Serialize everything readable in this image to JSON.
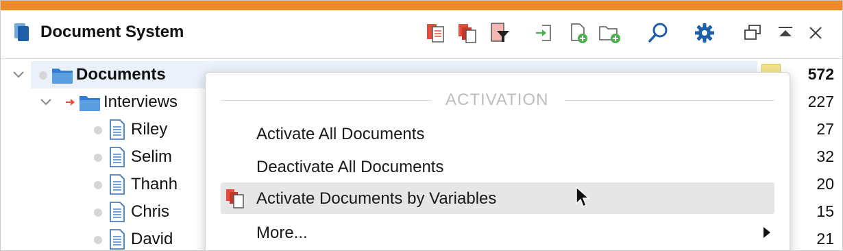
{
  "window": {
    "title": "Document System"
  },
  "toolbar": {
    "icons": [
      "documents-activate-icon",
      "documents-copy-icon",
      "document-filter-icon",
      "import-icon",
      "new-document-icon",
      "new-folder-icon",
      "search-icon",
      "settings-gear-icon",
      "undock-window-icon",
      "collapse-icon",
      "close-icon"
    ],
    "accent": "#ef8a2c"
  },
  "tree": {
    "root": {
      "label": "Documents",
      "count": "572"
    },
    "group": {
      "label": "Interviews",
      "count": "227"
    },
    "docs": [
      {
        "label": "Riley",
        "count": "27"
      },
      {
        "label": "Selim",
        "count": "32"
      },
      {
        "label": "Thanh",
        "count": "20"
      },
      {
        "label": "Chris",
        "count": "15"
      },
      {
        "label": "David",
        "count": "21"
      }
    ]
  },
  "context_menu": {
    "section_title": "ACTIVATION",
    "items": [
      {
        "label": "Activate All Documents"
      },
      {
        "label": "Deactivate All Documents"
      },
      {
        "label": "Activate Documents by Variables"
      },
      {
        "label": "More..."
      }
    ]
  }
}
